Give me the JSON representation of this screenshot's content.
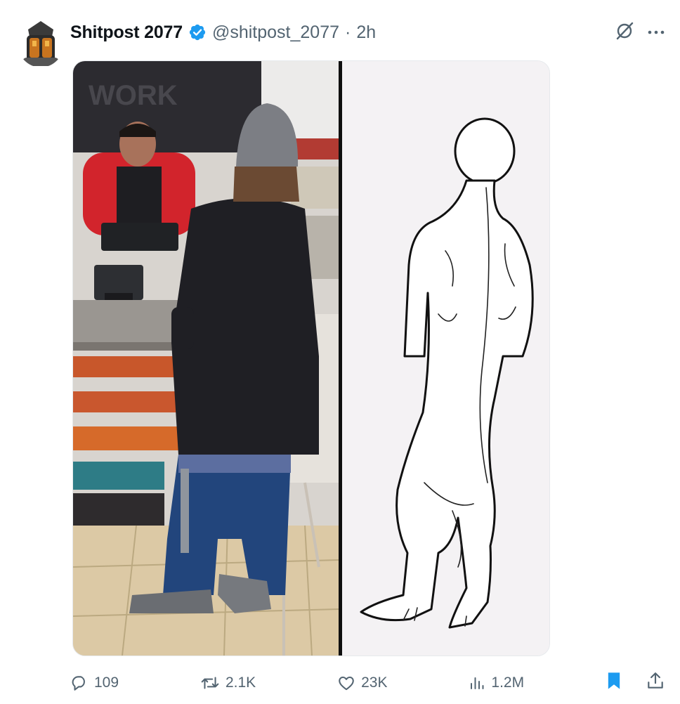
{
  "tweet": {
    "display_name": "Shitpost 2077",
    "handle": "@shitpost_2077",
    "separator": "·",
    "time": "2h",
    "verified_color": "#1d9bf0"
  },
  "icons": {
    "verified": "verified-badge-icon",
    "grok": "grok-icon",
    "more": "more-options-icon",
    "reply": "reply-icon",
    "retweet": "retweet-icon",
    "like": "like-icon",
    "views": "views-icon",
    "bookmark": "bookmark-icon",
    "share": "share-icon"
  },
  "stats": {
    "replies": "109",
    "retweets": "2.1K",
    "likes": "23K",
    "views": "1.2M"
  },
  "colors": {
    "text": "#0f1419",
    "secondary": "#536471",
    "accent": "#1d9bf0"
  }
}
